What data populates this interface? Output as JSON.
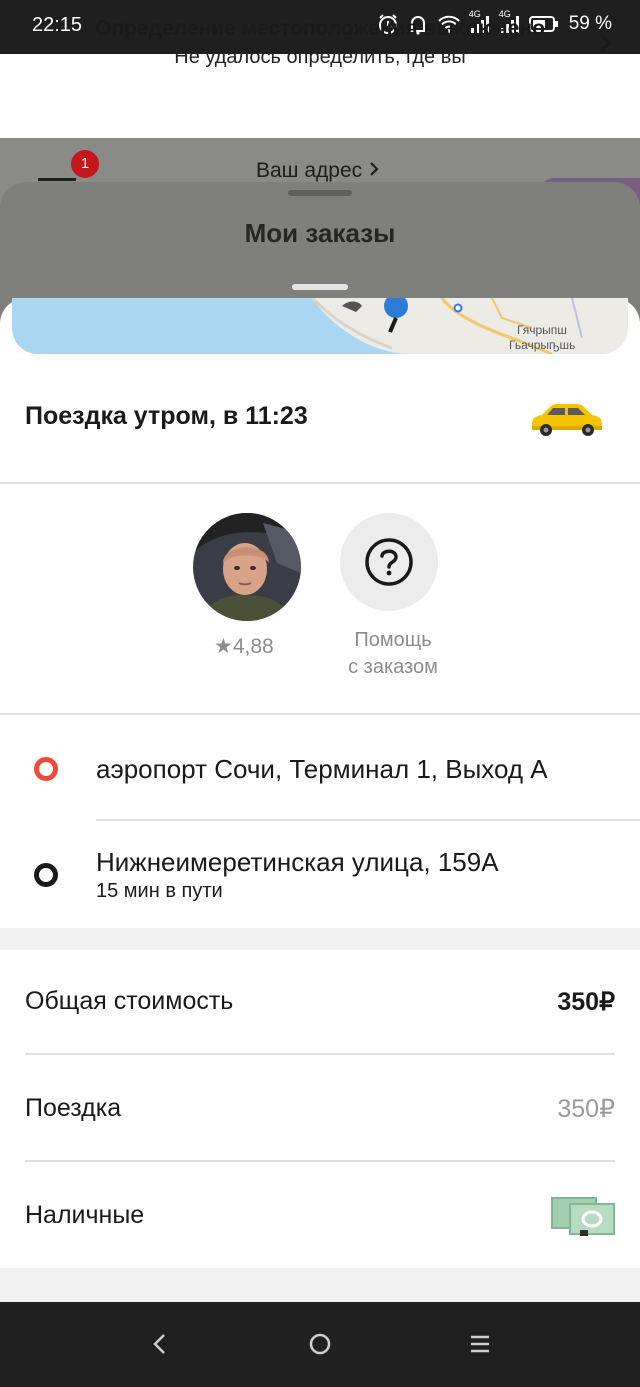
{
  "status_bar": {
    "time": "22:15",
    "network_label_1": "4G",
    "network_label_2": "4G",
    "battery_percent": "59 %",
    "icons": [
      "alarm-icon",
      "bell-icon",
      "wifi-icon",
      "signal-icon",
      "signal-icon",
      "battery-icon"
    ]
  },
  "location_banner": {
    "title": "Определение местоположения выключено",
    "subtitle": "Не удалось определить, где вы"
  },
  "map_header": {
    "notification_count": "1",
    "address_label": "Ваш адрес"
  },
  "orders_sheet": {
    "title": "Мои заказы"
  },
  "map_strip": {
    "place_label_1": "Гячрыпш",
    "place_label_2": "Гьачрыҧшь"
  },
  "order": {
    "title": "Поездка утром, в 11:23",
    "driver": {
      "rating": "4,88"
    },
    "help": {
      "line1": "Помощь",
      "line2": "с заказом"
    },
    "route": {
      "from": "аэропорт Сочи, Терминал 1, Выход А",
      "to": "Нижнеимеретинская улица, 159А",
      "eta": "15 мин в пути"
    },
    "payment": {
      "total_label": "Общая стоимость",
      "total_value": "350₽",
      "trip_label": "Поездка",
      "trip_value": "350₽",
      "method_label": "Наличные"
    }
  },
  "colors": {
    "accent_origin": "#f0483b",
    "badge": "#c4161c",
    "taxi_yellow": "#f5c400",
    "status_bar_bg": "#1f1f1f"
  }
}
